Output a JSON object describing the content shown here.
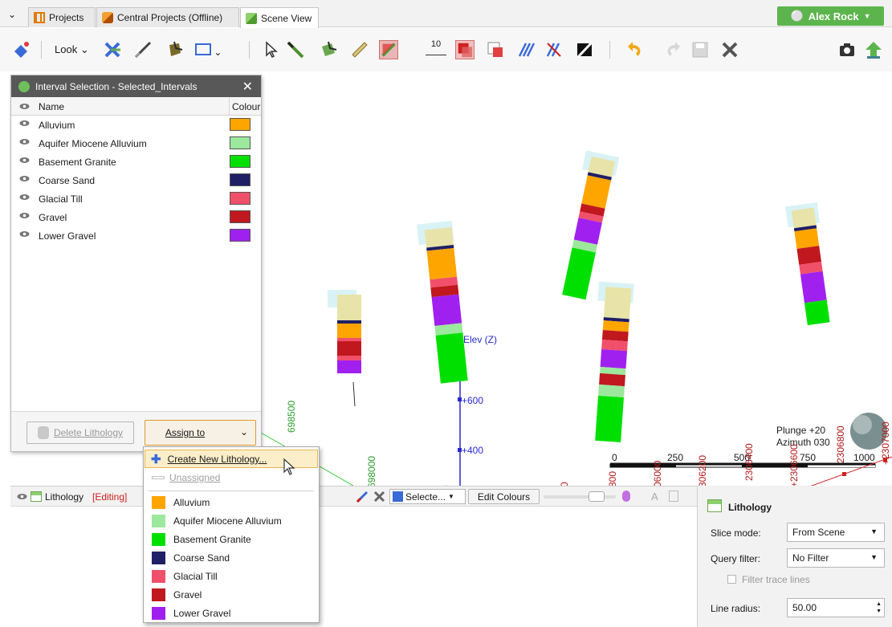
{
  "tabs": {
    "projects": "Projects",
    "central": "Central Projects (Offline)",
    "scene": "Scene View"
  },
  "user": {
    "name": "Alex Rock"
  },
  "toolbar": {
    "look_label": "Look",
    "scale_value": "10"
  },
  "selection_panel": {
    "title": "Interval Selection - Selected_Intervals",
    "col_name": "Name",
    "col_colour": "Colour",
    "rows": [
      {
        "name": "Alluvium",
        "color": "#ffa500"
      },
      {
        "name": "Aquifer Miocene Alluvium",
        "color": "#9ce89c"
      },
      {
        "name": "Basement Granite",
        "color": "#00e000"
      },
      {
        "name": "Coarse Sand",
        "color": "#1f1f66"
      },
      {
        "name": "Glacial Till",
        "color": "#f0506a"
      },
      {
        "name": "Gravel",
        "color": "#c0181e"
      },
      {
        "name": "Lower Gravel",
        "color": "#a020f0"
      }
    ],
    "delete_label": "Delete Lithology",
    "assign_label": "Assign to"
  },
  "menu": {
    "create_label": "Create New Lithology...",
    "unassigned_label": "Unassigned",
    "items": [
      {
        "name": "Alluvium",
        "color": "#ffa500"
      },
      {
        "name": "Aquifer Miocene Alluvium",
        "color": "#9ce89c"
      },
      {
        "name": "Basement Granite",
        "color": "#00e000"
      },
      {
        "name": "Coarse Sand",
        "color": "#1f1f66"
      },
      {
        "name": "Glacial Till",
        "color": "#f0506a"
      },
      {
        "name": "Gravel",
        "color": "#c0181e"
      },
      {
        "name": "Lower Gravel",
        "color": "#a020f0"
      }
    ]
  },
  "scene": {
    "axis_label": "Elev (Z)",
    "elev_600": "+600",
    "elev_400": "+400",
    "northing_1": "698500",
    "northing_2": "698000",
    "scale_0": "0",
    "scale_250": "250",
    "scale_500": "500",
    "scale_750": "750",
    "scale_1000": "1000",
    "plunge": "Plunge +20",
    "azimuth": "Azimuth 030",
    "easting_1": "+2307000",
    "easting_2": "2306800",
    "easting_3": "+2306600",
    "easting_4": "2306400",
    "easting_5": "306200",
    "easting_6": "06000",
    "easting_7": "800",
    "easting_8": "0"
  },
  "bottom": {
    "title": "Lithology",
    "editing": "[Editing]",
    "select_label": "Selecte...",
    "edit_colours": "Edit Colours"
  },
  "properties": {
    "title": "Lithology",
    "slice_mode_label": "Slice mode:",
    "slice_mode_value": "From Scene",
    "query_filter_label": "Query filter:",
    "query_filter_value": "No Filter",
    "filter_trace_label": "Filter trace lines",
    "line_radius_label": "Line radius:",
    "line_radius_value": "50.00"
  }
}
